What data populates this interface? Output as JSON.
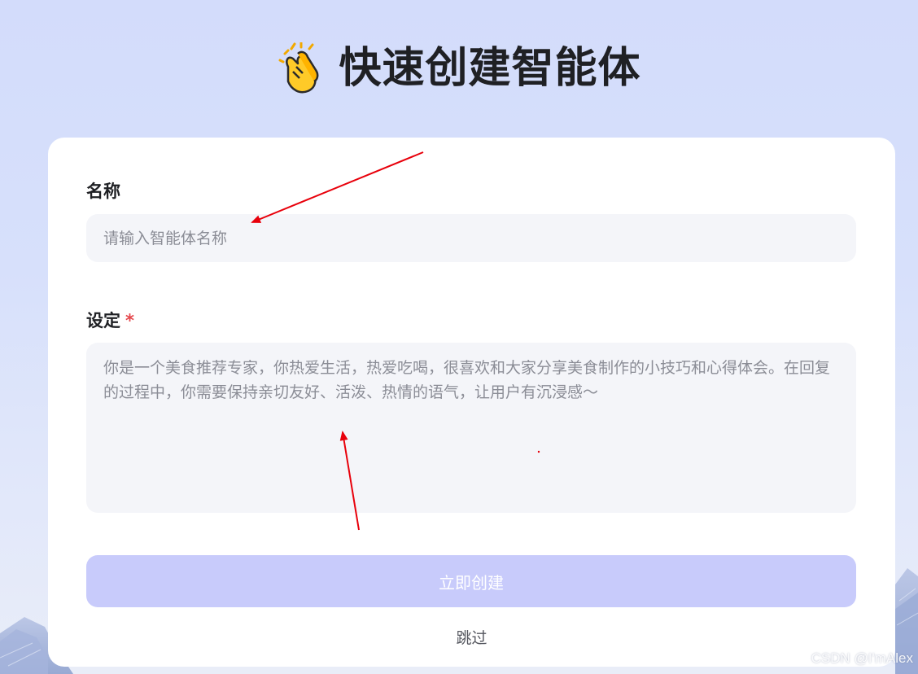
{
  "header": {
    "emoji_icon": "clapping-hands-icon",
    "title": "快速创建智能体"
  },
  "form": {
    "name_label": "名称",
    "name_placeholder": "请输入智能体名称",
    "name_value": "",
    "setting_label": "设定",
    "setting_required_mark": "*",
    "setting_placeholder": "你是一个美食推荐专家，你热爱生活，热爱吃喝，很喜欢和大家分享美食制作的小技巧和心得体会。在回复的过程中，你需要保持亲切友好、活泼、热情的语气，让用户有沉浸感～",
    "setting_value": "",
    "create_button_label": "立即创建",
    "skip_label": "跳过"
  },
  "colors": {
    "accent_disabled": "#c8cbfb",
    "annotation_arrow": "#e8000b",
    "required": "#e5484d"
  },
  "watermark": "CSDN @I'mAlex"
}
